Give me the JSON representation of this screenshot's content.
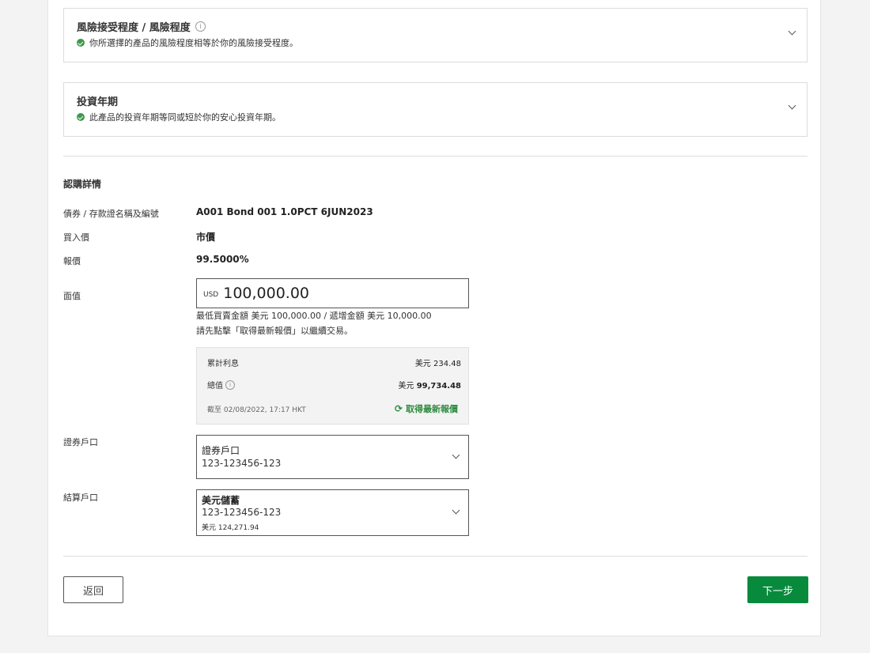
{
  "risk_section": {
    "title": "風險接受程度 / 風險程度",
    "message": "你所選擇的產品的風險程度相等於你的風險接受程度。"
  },
  "tenor_section": {
    "title": "投資年期",
    "message": "此產品的投資年期等同或短於你的安心投資年期。"
  },
  "subscription": {
    "title": "認購詳情",
    "bond_name_label": "債券 / 存款證名稱及編號",
    "bond_name_value": "A001 Bond 001 1.0PCT 6JUN2023",
    "buy_price_label": "買入價",
    "buy_price_value": "市價",
    "quote_label": "報價",
    "quote_value": "99.5000%",
    "face_value_label": "面值",
    "face_value_currency": "USD",
    "face_value_amount": "100,000.00",
    "min_amount_hint": "最低買賣金額 美元 100,000.00 / 遞增金額 美元 10,000.00",
    "refresh_hint": "請先點擊「取得最新報價」以繼續交易。"
  },
  "quote_panel": {
    "accrued_interest_label": "累計利息",
    "accrued_interest_currency": "美元",
    "accrued_interest_value": "234.48",
    "total_label": "總值",
    "total_currency": "美元",
    "total_value": "99,734.48",
    "as_of_text": "截至 02/08/2022, 17:17 HKT",
    "refresh_label": "取得最新報價"
  },
  "securities_account": {
    "label": "證券戶口",
    "selected_title": "證券戶口",
    "selected_number": "123-123456-123"
  },
  "settlement_account": {
    "label": "結算戶口",
    "selected_title": "美元儲蓄",
    "selected_number": "123-123456-123",
    "selected_balance": "美元 124,271.94"
  },
  "actions": {
    "back_label": "返回",
    "next_label": "下一步"
  },
  "colors": {
    "primary_green": "#078a3c",
    "success_green": "#3b9b49"
  }
}
